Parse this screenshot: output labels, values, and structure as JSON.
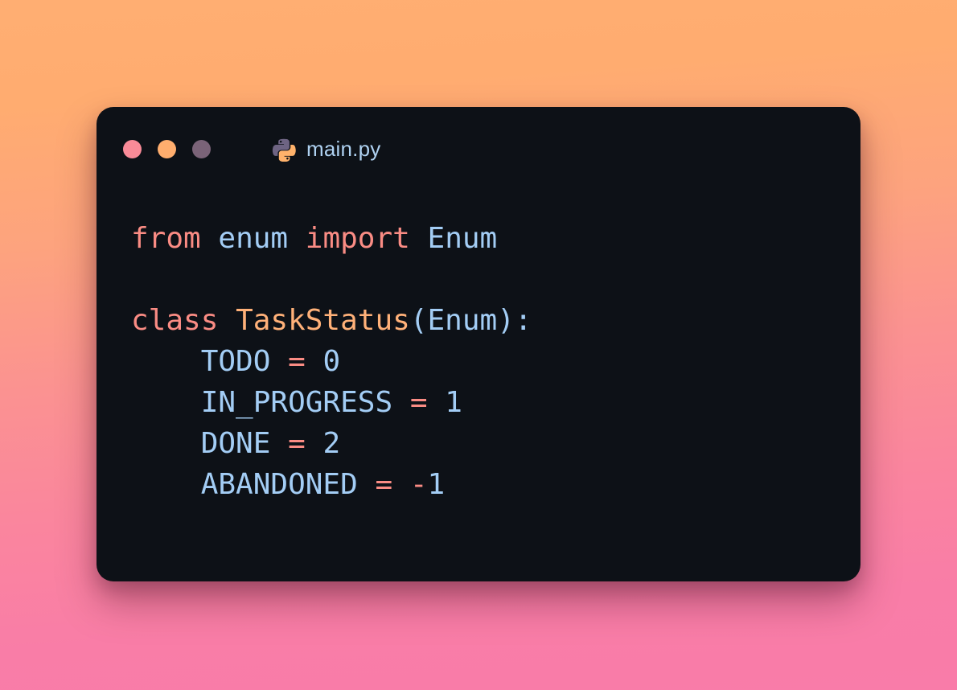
{
  "window": {
    "file_name": "main.py",
    "file_icon": "python-icon",
    "traffic_lights": [
      {
        "name": "close",
        "color": "#F98B98"
      },
      {
        "name": "minimize",
        "color": "#FFAE6E"
      },
      {
        "name": "maximize",
        "color": "#7A6378"
      }
    ],
    "background": "#0D1117"
  },
  "backdrop": {
    "gradient_from": "#FFAE72",
    "gradient_to": "#F97CA9"
  },
  "theme": {
    "keyword": "#FA8C84",
    "class_name": "#FFB179",
    "identifier": "#A3CDF5",
    "number": "#A3CDF5",
    "operator": "#FA8C84",
    "punctuation": "#A3CDF5",
    "filename_text": "#AFD2F2"
  },
  "code": {
    "language": "python",
    "lines": [
      {
        "tokens": [
          {
            "t": "from",
            "c": "kw"
          },
          {
            "t": " ",
            "c": "plain"
          },
          {
            "t": "enum",
            "c": "name"
          },
          {
            "t": " ",
            "c": "plain"
          },
          {
            "t": "import",
            "c": "kw"
          },
          {
            "t": " ",
            "c": "plain"
          },
          {
            "t": "Enum",
            "c": "name"
          }
        ]
      },
      {
        "tokens": []
      },
      {
        "tokens": [
          {
            "t": "class",
            "c": "kw"
          },
          {
            "t": " ",
            "c": "plain"
          },
          {
            "t": "TaskStatus",
            "c": "cls"
          },
          {
            "t": "(",
            "c": "punct"
          },
          {
            "t": "Enum",
            "c": "name"
          },
          {
            "t": ")",
            "c": "punct"
          },
          {
            "t": ":",
            "c": "punct"
          }
        ]
      },
      {
        "tokens": [
          {
            "t": "    ",
            "c": "plain"
          },
          {
            "t": "TODO",
            "c": "name"
          },
          {
            "t": " ",
            "c": "plain"
          },
          {
            "t": "=",
            "c": "op"
          },
          {
            "t": " ",
            "c": "plain"
          },
          {
            "t": "0",
            "c": "num"
          }
        ]
      },
      {
        "tokens": [
          {
            "t": "    ",
            "c": "plain"
          },
          {
            "t": "IN_PROGRESS",
            "c": "name"
          },
          {
            "t": " ",
            "c": "plain"
          },
          {
            "t": "=",
            "c": "op"
          },
          {
            "t": " ",
            "c": "plain"
          },
          {
            "t": "1",
            "c": "num"
          }
        ]
      },
      {
        "tokens": [
          {
            "t": "    ",
            "c": "plain"
          },
          {
            "t": "DONE",
            "c": "name"
          },
          {
            "t": " ",
            "c": "plain"
          },
          {
            "t": "=",
            "c": "op"
          },
          {
            "t": " ",
            "c": "plain"
          },
          {
            "t": "2",
            "c": "num"
          }
        ]
      },
      {
        "tokens": [
          {
            "t": "    ",
            "c": "plain"
          },
          {
            "t": "ABANDONED",
            "c": "name"
          },
          {
            "t": " ",
            "c": "plain"
          },
          {
            "t": "=",
            "c": "op"
          },
          {
            "t": " ",
            "c": "plain"
          },
          {
            "t": "-",
            "c": "op"
          },
          {
            "t": "1",
            "c": "num"
          }
        ]
      }
    ],
    "plain_text": "from enum import Enum\n\nclass TaskStatus(Enum):\n    TODO = 0\n    IN_PROGRESS = 1\n    DONE = 2\n    ABANDONED = -1"
  }
}
